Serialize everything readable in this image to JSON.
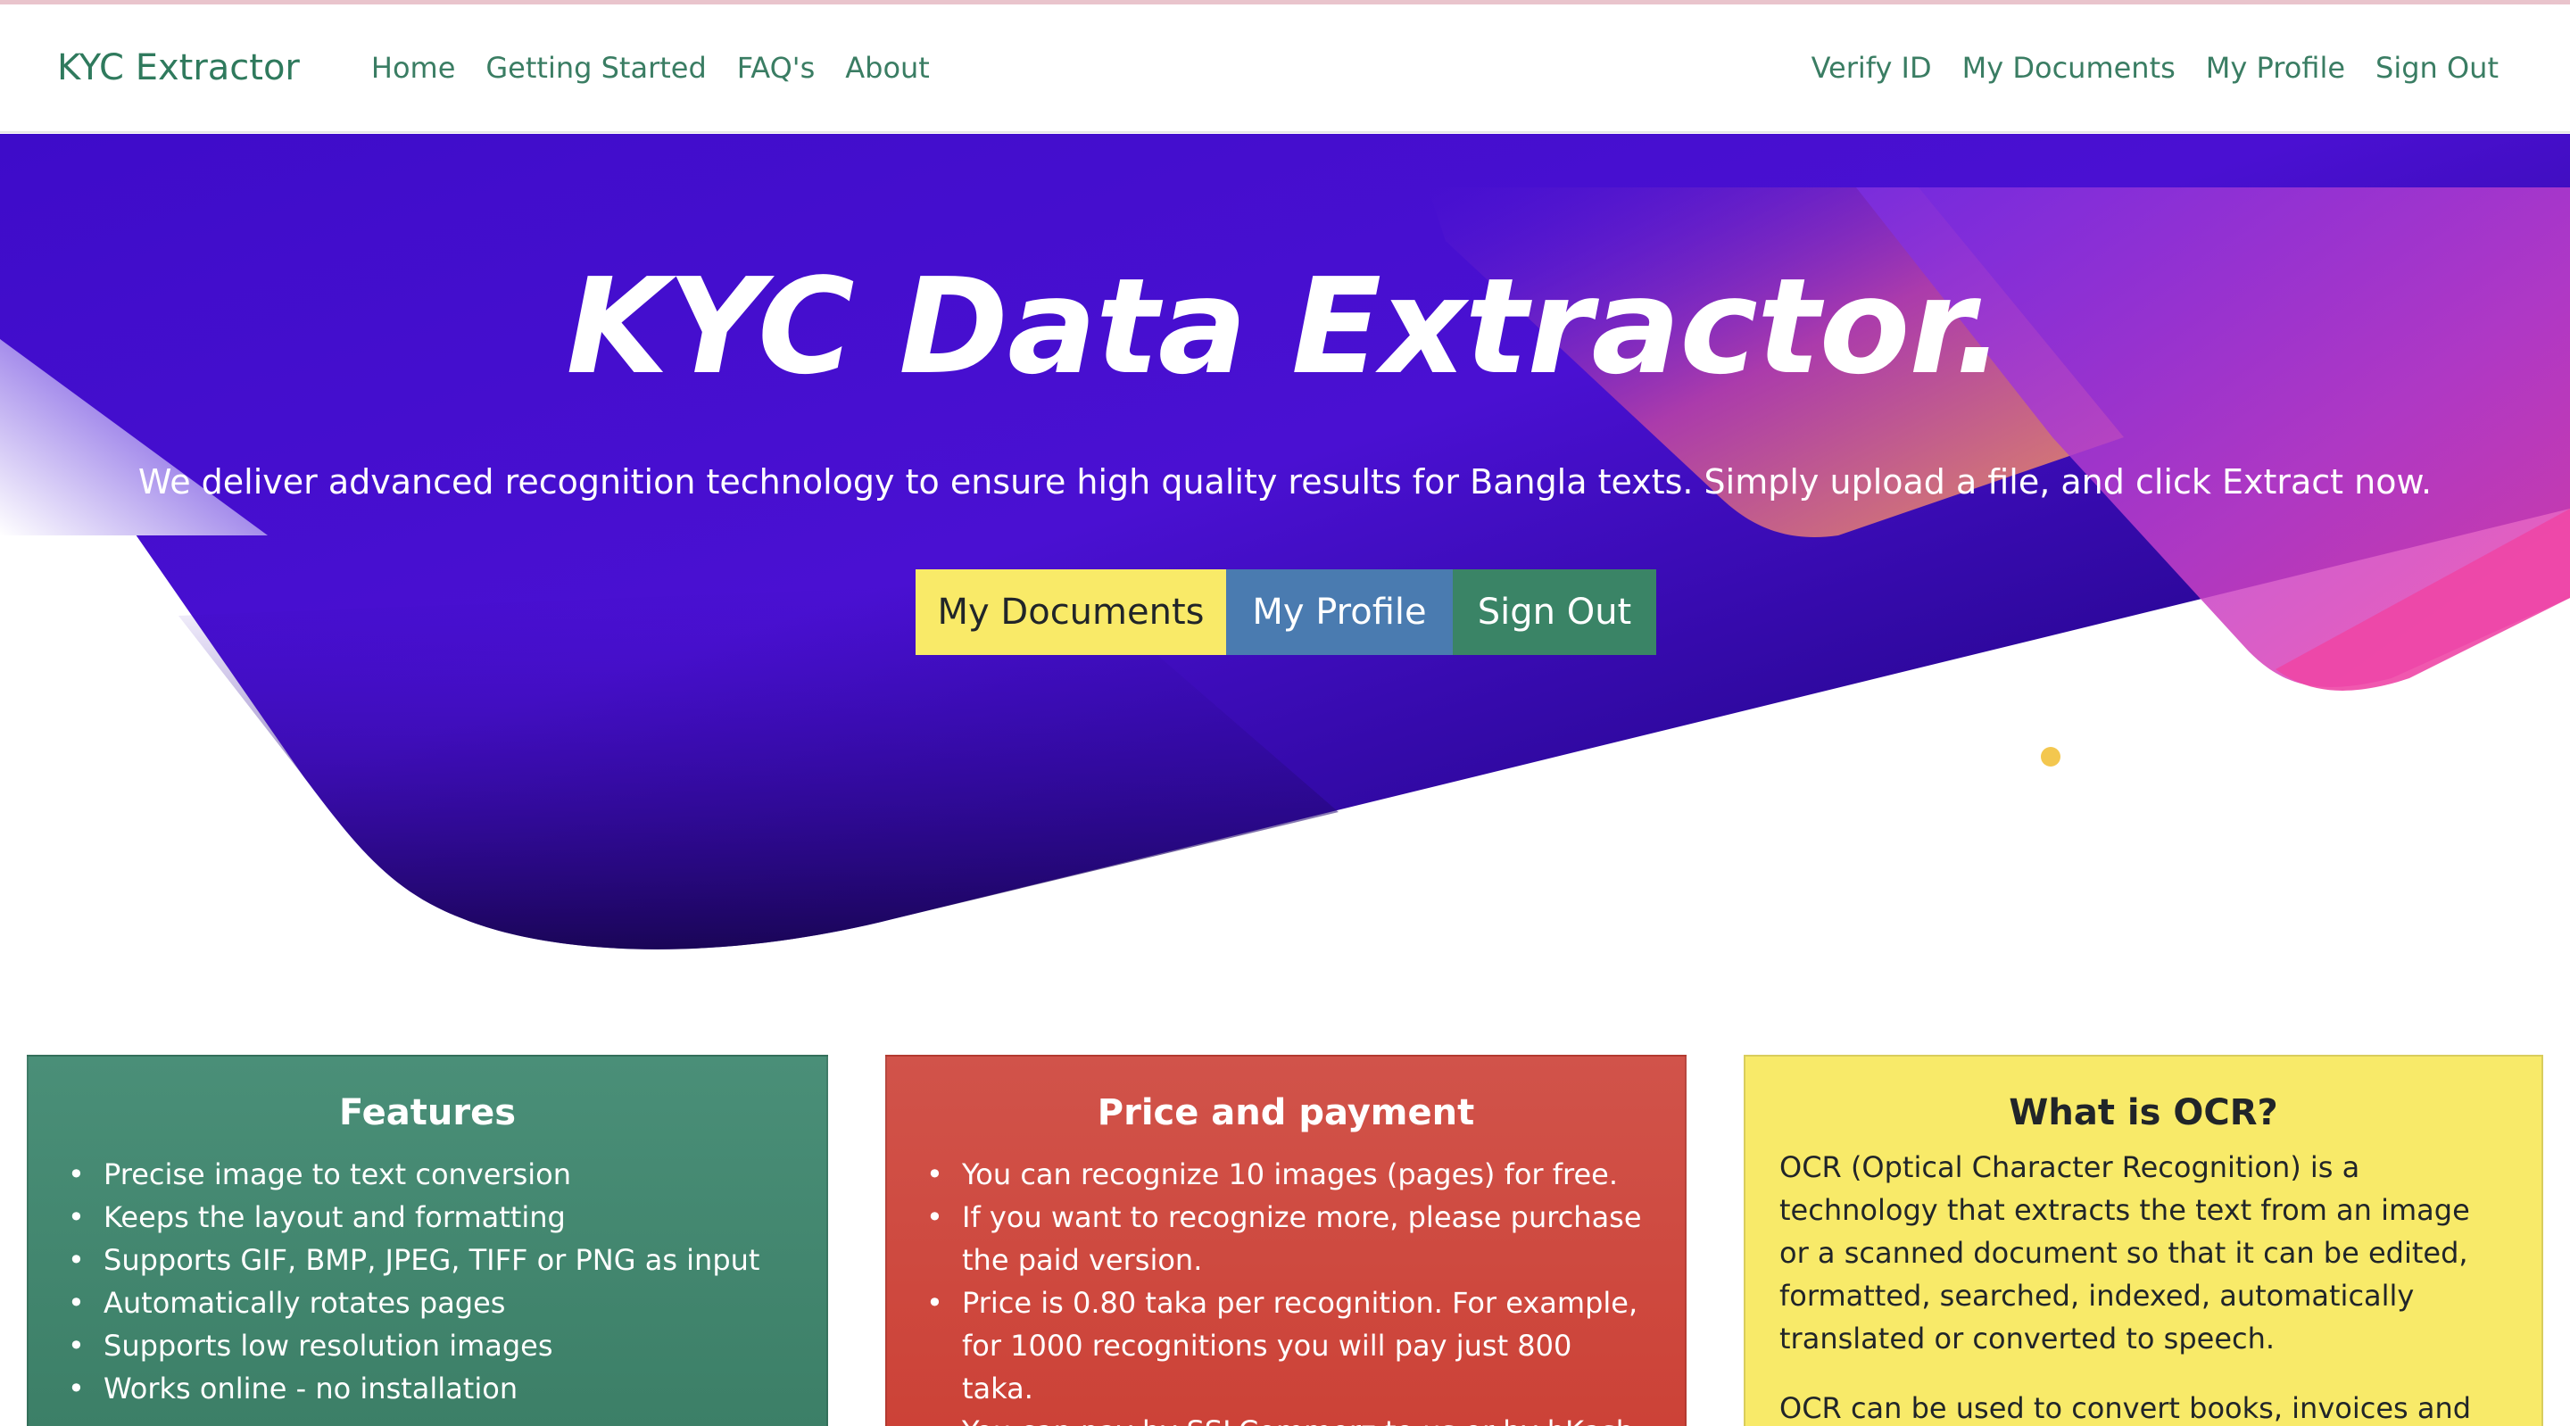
{
  "navbar": {
    "brand": "KYC Extractor",
    "left_links": [
      "Home",
      "Getting Started",
      "FAQ's",
      "About"
    ],
    "right_links": [
      "Verify ID",
      "My Documents",
      "My Profile",
      "Sign Out"
    ]
  },
  "hero": {
    "title": "KYC Data Extractor.",
    "subtitle": "We deliver advanced recognition technology to ensure high quality results for Bangla texts. Simply upload a file, and click Extract now.",
    "buttons": {
      "documents": "My Documents",
      "profile": "My Profile",
      "signout": "Sign Out"
    }
  },
  "cards": {
    "features": {
      "title": "Features",
      "items": [
        "Precise image to text conversion",
        "Keeps the layout and formatting",
        "Supports GIF, BMP, JPEG, TIFF or PNG as input",
        "Automatically rotates pages",
        "Supports low resolution images",
        "Works online - no installation"
      ]
    },
    "price": {
      "title": "Price and payment",
      "items": [
        "You can recognize 10 images (pages) for free.",
        "If you want to recognize more, please purchase the paid version.",
        "Price is 0.80 taka per recognition. For example, for 1000 recognitions you will pay just 800 taka.",
        "You can pay by SSLCommerz to us or by bKash"
      ]
    },
    "ocr": {
      "title": "What is OCR?",
      "paragraphs": [
        "OCR (Optical Character Recognition) is a technology that extracts the text from an image or a scanned document so that it can be edited, formatted, searched, indexed, automatically translated or converted to speech.",
        "OCR can be used to convert books, invoices and other"
      ]
    }
  },
  "colors": {
    "brand_green": "#2f7a5d",
    "hero_purple": "#4a0fd0",
    "button_yellow": "#f9ea68",
    "button_blue": "#4a7bb0",
    "button_green": "#3a8466",
    "card_red": "#cc4237",
    "card_yellow": "#f8ea69"
  }
}
